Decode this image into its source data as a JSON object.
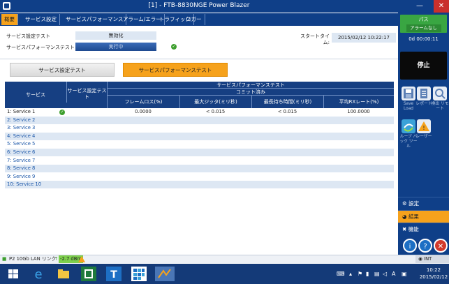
{
  "window": {
    "title": "[1] - FTB-8830NGE Power Blazer",
    "min_label": "—",
    "close_label": "✕"
  },
  "tabs": [
    {
      "label": "概要",
      "active": true
    },
    {
      "label": "サービス設定",
      "active": false
    },
    {
      "label": "サービスパフォーマンス",
      "active": false
    },
    {
      "label": "アラーム/エラー",
      "active": false
    },
    {
      "label": "トラフィック",
      "active": false
    },
    {
      "label": "ロガー",
      "active": false
    }
  ],
  "status": {
    "config_label": "サービス設定テスト",
    "config_value": "無効化",
    "perf_label": "サービスパフォーマンステスト",
    "perf_value": "実行中",
    "start_time_label": "スタートタイム:",
    "start_time_value": "2015/02/12 10:22:17"
  },
  "toggles": {
    "config_test": "サービス設定テスト",
    "perf_test": "サービスパフォーマンステスト"
  },
  "table": {
    "col_service": "サービス",
    "col_config": "サービス設定テスト",
    "group_header": "サービスパフォーマンステスト",
    "subgroup_header": "コミット済み",
    "sub_headers": [
      "フレームロス(%)",
      "最大ジッタ(ミリ秒)",
      "最長待ち時間(ミリ秒)",
      "平均RXレート(%)"
    ],
    "rows": [
      {
        "name": "1: Service 1",
        "check": true,
        "values": [
          "0.0000",
          "< 0.015",
          "< 0.015",
          "100.0000"
        ]
      },
      {
        "name": "2: Service 2",
        "check": false,
        "values": [
          "",
          "",
          "",
          ""
        ]
      },
      {
        "name": "3: Service 3",
        "check": false,
        "values": [
          "",
          "",
          "",
          ""
        ]
      },
      {
        "name": "4: Service 4",
        "check": false,
        "values": [
          "",
          "",
          "",
          ""
        ]
      },
      {
        "name": "5: Service 5",
        "check": false,
        "values": [
          "",
          "",
          "",
          ""
        ]
      },
      {
        "name": "6: Service 6",
        "check": false,
        "values": [
          "",
          "",
          "",
          ""
        ]
      },
      {
        "name": "7: Service 7",
        "check": false,
        "values": [
          "",
          "",
          "",
          ""
        ]
      },
      {
        "name": "8: Service 8",
        "check": false,
        "values": [
          "",
          "",
          "",
          ""
        ]
      },
      {
        "name": "9: Service 9",
        "check": false,
        "values": [
          "",
          "",
          "",
          ""
        ]
      },
      {
        "name": "10: Service 10",
        "check": false,
        "values": [
          "",
          "",
          "",
          ""
        ]
      }
    ]
  },
  "right_panel": {
    "verdict": "パス",
    "alarm": "アラームなし",
    "timer": "0d 00:00:11",
    "stop": "停止",
    "tools": [
      {
        "label": "Save Load",
        "icon": "save-icon"
      },
      {
        "label": "レポート",
        "icon": "report-icon"
      },
      {
        "label": "検出 リモート",
        "icon": "discover-remote-icon"
      },
      {
        "label": "ループ バック ツール",
        "icon": "loopback-tool-icon"
      },
      {
        "label": "レーザー",
        "icon": "laser-icon"
      }
    ],
    "menu": [
      {
        "label": "設定",
        "icon": "gear-icon",
        "active": false
      },
      {
        "label": "結果",
        "icon": "results-icon",
        "active": true
      },
      {
        "label": "機能",
        "icon": "functions-icon",
        "active": false
      }
    ]
  },
  "statusbar": {
    "port": "P2 10Gb LAN",
    "link": "リンク",
    "power": "-2.7 dBm",
    "clock_source": "INT"
  },
  "taskbar": {
    "time": "10:22",
    "date": "2015/02/12",
    "ime": "A"
  },
  "colors": {
    "brand_blue": "#0f3f88",
    "accent_orange": "#f6a21c",
    "pass_green": "#39a642"
  }
}
